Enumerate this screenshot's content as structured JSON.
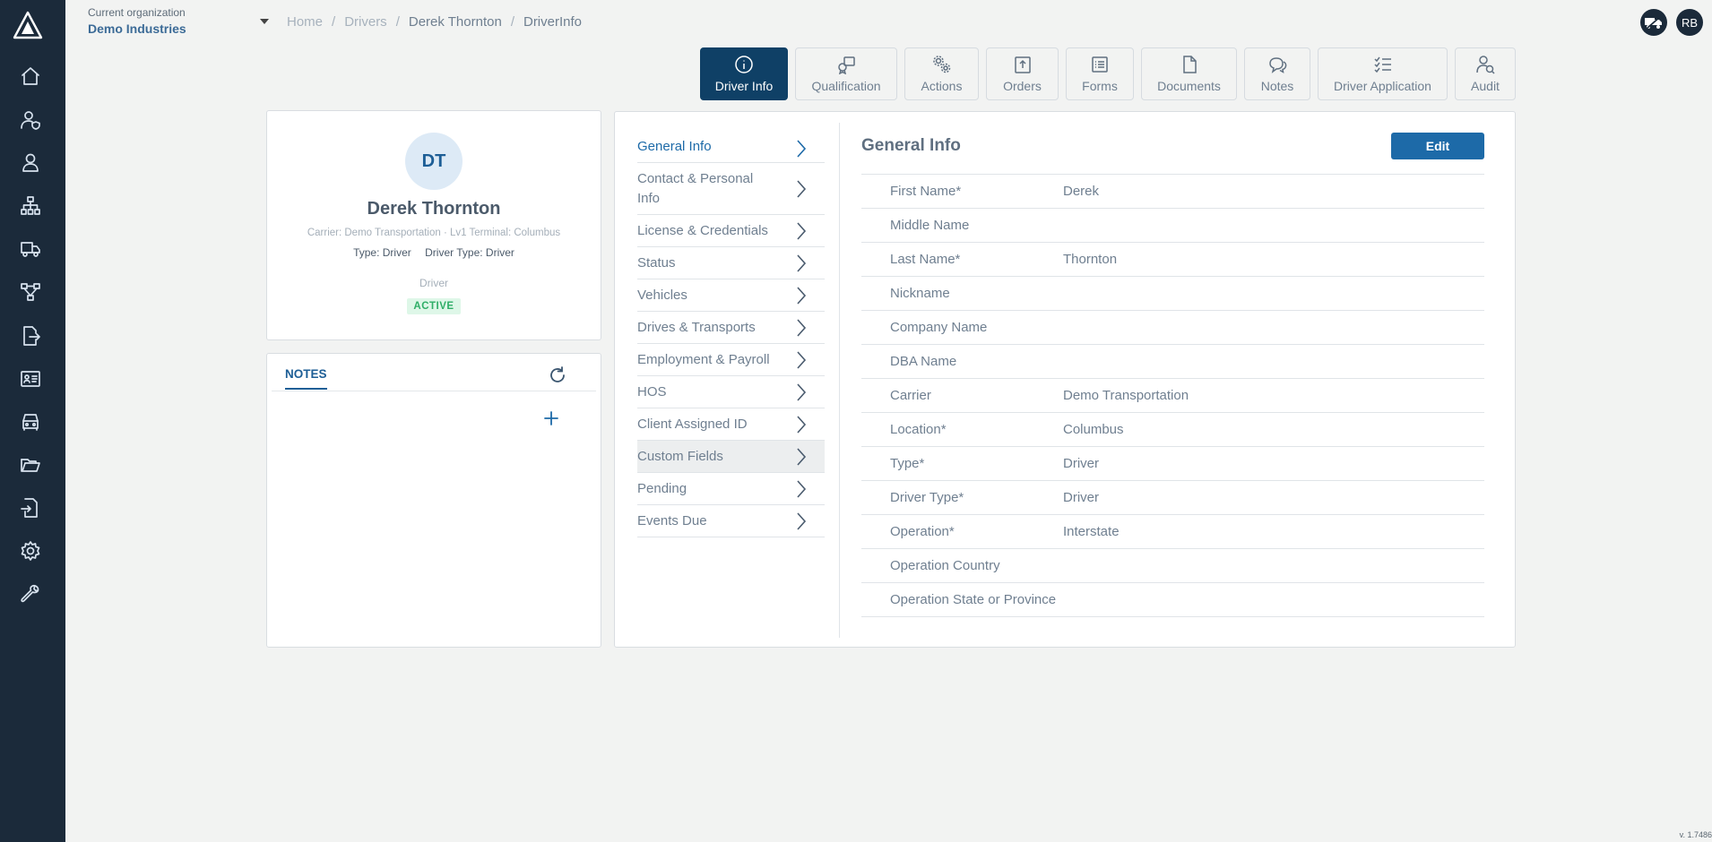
{
  "header": {
    "org_label": "Current organization",
    "org_name": "Demo Industries",
    "breadcrumb": [
      "Home",
      "Drivers",
      "Derek Thornton",
      "DriverInfo"
    ],
    "user_initials": "RB"
  },
  "sidebar": {
    "items": [
      "home-icon",
      "user-shield-icon",
      "user-icon",
      "org-chart-icon",
      "truck-icon",
      "workflow-icon",
      "file-export-icon",
      "id-card-icon",
      "vehicle-icon",
      "folder-open-icon",
      "file-import-icon",
      "gear-icon",
      "wrench-icon"
    ]
  },
  "tabs": [
    {
      "label": "Driver Info",
      "icon": "info-icon",
      "active": true
    },
    {
      "label": "Qualification",
      "icon": "qualification-icon"
    },
    {
      "label": "Actions",
      "icon": "gears-icon"
    },
    {
      "label": "Orders",
      "icon": "upload-icon"
    },
    {
      "label": "Forms",
      "icon": "list-icon"
    },
    {
      "label": "Documents",
      "icon": "document-icon"
    },
    {
      "label": "Notes",
      "icon": "chat-icon"
    },
    {
      "label": "Driver Application",
      "icon": "checklist-icon"
    },
    {
      "label": "Audit",
      "icon": "user-search-icon"
    }
  ],
  "profile": {
    "initials": "DT",
    "name": "Derek Thornton",
    "carrier_line": "Carrier: Demo Transportation · Lv1 Terminal: Columbus",
    "type": "Type: Driver",
    "driver_type": "Driver Type: Driver",
    "role": "Driver",
    "status": "ACTIVE"
  },
  "notes": {
    "tab_label": "NOTES"
  },
  "menu": [
    "General Info",
    "Contact & Personal Info",
    "License & Credentials",
    "Status",
    "Vehicles",
    "Drives & Transports",
    "Employment & Payroll",
    "HOS",
    "Client Assigned ID",
    "Custom Fields",
    "Pending",
    "Events Due"
  ],
  "general_info": {
    "title": "General Info",
    "edit_label": "Edit",
    "fields": [
      {
        "label": "First Name*",
        "value": "Derek"
      },
      {
        "label": "Middle Name",
        "value": ""
      },
      {
        "label": "Last Name*",
        "value": "Thornton"
      },
      {
        "label": "Nickname",
        "value": ""
      },
      {
        "label": "Company Name",
        "value": ""
      },
      {
        "label": "DBA Name",
        "value": ""
      },
      {
        "label": "Carrier",
        "value": "Demo Transportation"
      },
      {
        "label": "Location*",
        "value": "Columbus"
      },
      {
        "label": "Type*",
        "value": "Driver"
      },
      {
        "label": "Driver Type*",
        "value": "Driver"
      },
      {
        "label": "Operation*",
        "value": "Interstate"
      },
      {
        "label": "Operation Country",
        "value": ""
      },
      {
        "label": "Operation State or Province",
        "value": ""
      }
    ]
  },
  "version": "v. 1.7486"
}
